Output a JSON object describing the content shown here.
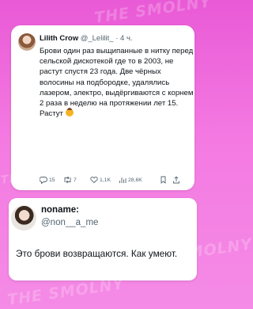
{
  "watermark": {
    "text": "THE SMOLNY"
  },
  "tweet": {
    "author_name": "Lilith Crow",
    "handle": "@_Lelilit_",
    "separator": "·",
    "time": "4 ч.",
    "text": "Брови один раз выщипанные в нитку перед сельской дискотекой где то в 2003, не растут спустя 23 года. Две чёрных волосины на подбородке, удалялись лазером, электро, выдёргиваются с корнем 2 раза в неделю на протяжении лет 15. Растут",
    "emoji_icon": "woman-facepalming-emoji",
    "actions": {
      "replies": "15",
      "retweets": "7",
      "likes": "1,1K",
      "views": "28,6K"
    }
  },
  "reply": {
    "author_name": "noname:",
    "handle": "@non__a_me",
    "text": "Это брови возвращаются. Как умеют."
  },
  "colors": {
    "background_top": "#e95ad6",
    "background_bottom": "#f58be6",
    "text_primary": "#0f1419",
    "text_secondary": "#536471"
  }
}
